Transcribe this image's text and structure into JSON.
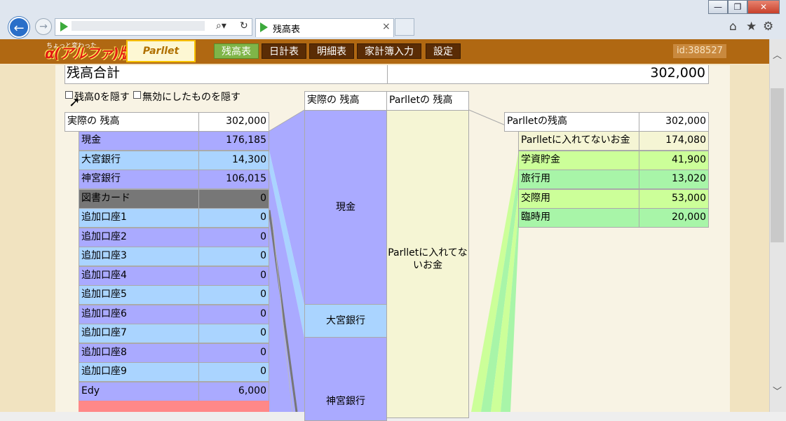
{
  "browser": {
    "tab_title": "残高表",
    "tab_close": "×",
    "window_buttons": [
      "—",
      "❐",
      "✕"
    ]
  },
  "header": {
    "logo_small": "ちょっと変わった",
    "logo_main": "α(アルファ)版",
    "logo_parllet": "Parllet",
    "nav": [
      "残高表",
      "日計表",
      "明細表",
      "家計簿入力",
      "設定"
    ],
    "active_nav": "残高表",
    "user_id": "id:388527"
  },
  "summary": {
    "label": "残高合計",
    "value": "302,000"
  },
  "options": {
    "hide_zero": "残高0を隠す",
    "hide_disabled": "無効にしたものを隠す"
  },
  "actual": {
    "header_label": "実際の 残高",
    "header_value": "302,000",
    "rows": [
      {
        "name": "現金",
        "value": "176,185",
        "color": "#aaaaff"
      },
      {
        "name": "大宮銀行",
        "value": "14,300",
        "color": "#aad4ff"
      },
      {
        "name": "神宮銀行",
        "value": "106,015",
        "color": "#aaaaff"
      },
      {
        "name": "図書カード",
        "value": "0",
        "color": "#777777"
      },
      {
        "name": "追加口座1",
        "value": "0",
        "color": "#aad4ff"
      },
      {
        "name": "追加口座2",
        "value": "0",
        "color": "#aaaaff"
      },
      {
        "name": "追加口座3",
        "value": "0",
        "color": "#aad4ff"
      },
      {
        "name": "追加口座4",
        "value": "0",
        "color": "#aaaaff"
      },
      {
        "name": "追加口座5",
        "value": "0",
        "color": "#aad4ff"
      },
      {
        "name": "追加口座6",
        "value": "0",
        "color": "#aaaaff"
      },
      {
        "name": "追加口座7",
        "value": "0",
        "color": "#aad4ff"
      },
      {
        "name": "追加口座8",
        "value": "0",
        "color": "#aaaaff"
      },
      {
        "name": "追加口座9",
        "value": "0",
        "color": "#aad4ff"
      },
      {
        "name": "Edy",
        "value": "6,000",
        "color": "#aaaaff"
      }
    ]
  },
  "middle": {
    "left_header": "実際の 残高",
    "right_header": "Parlletの 残高",
    "blocks": [
      "現金",
      "大宮銀行",
      "神宮銀行"
    ],
    "right_block": "Parlletに入れてないお金"
  },
  "parllet": {
    "header_label": "Parlletの残高",
    "header_value": "302,000",
    "rows": [
      {
        "name": "Parlletに入れてないお金",
        "value": "174,080",
        "color": "#f5f5d4"
      },
      {
        "name": "学資貯金",
        "value": "41,900",
        "color": "#ccff99"
      },
      {
        "name": "旅行用",
        "value": "13,020",
        "color": "#a8f5a8"
      },
      {
        "name": "交際用",
        "value": "53,000",
        "color": "#ccff99"
      },
      {
        "name": "臨時用",
        "value": "20,000",
        "color": "#a8f5a8"
      }
    ]
  }
}
